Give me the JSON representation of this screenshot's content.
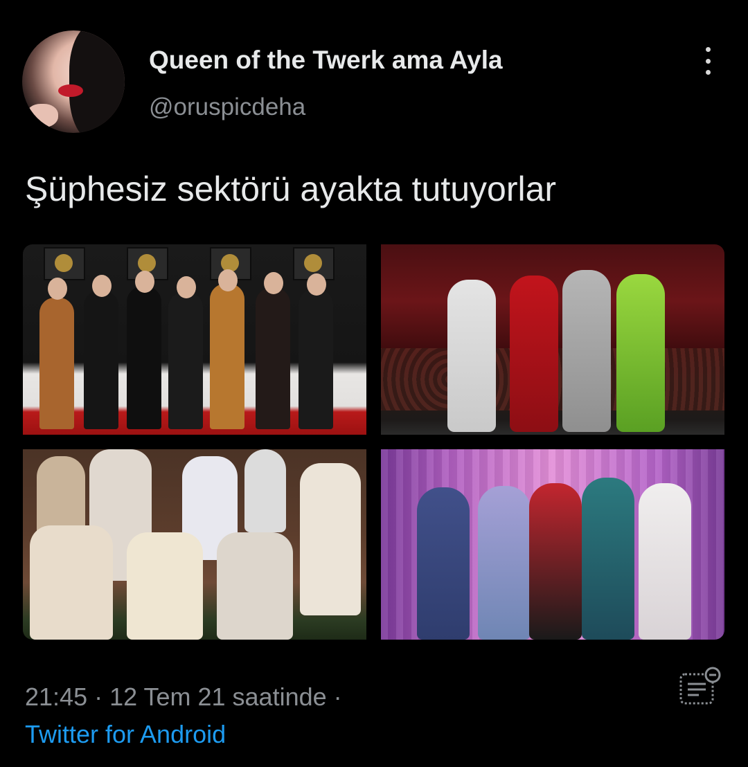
{
  "tweet": {
    "display_name": "Queen of the Twerk ama Ayla",
    "handle": "@oruspicdeha",
    "text": "Şüphesiz sektörü ayakta tutuyorlar",
    "timestamp": "21:45 · 12 Tem 21 saatinde ·",
    "client": "Twitter for Android"
  },
  "icons": {
    "more": "more-vertical-icon",
    "analytics": "analytics-icon"
  },
  "colors": {
    "background": "#000000",
    "text_primary": "#e7e9ea",
    "text_secondary": "#8b8f94",
    "link": "#1d9bf0"
  }
}
